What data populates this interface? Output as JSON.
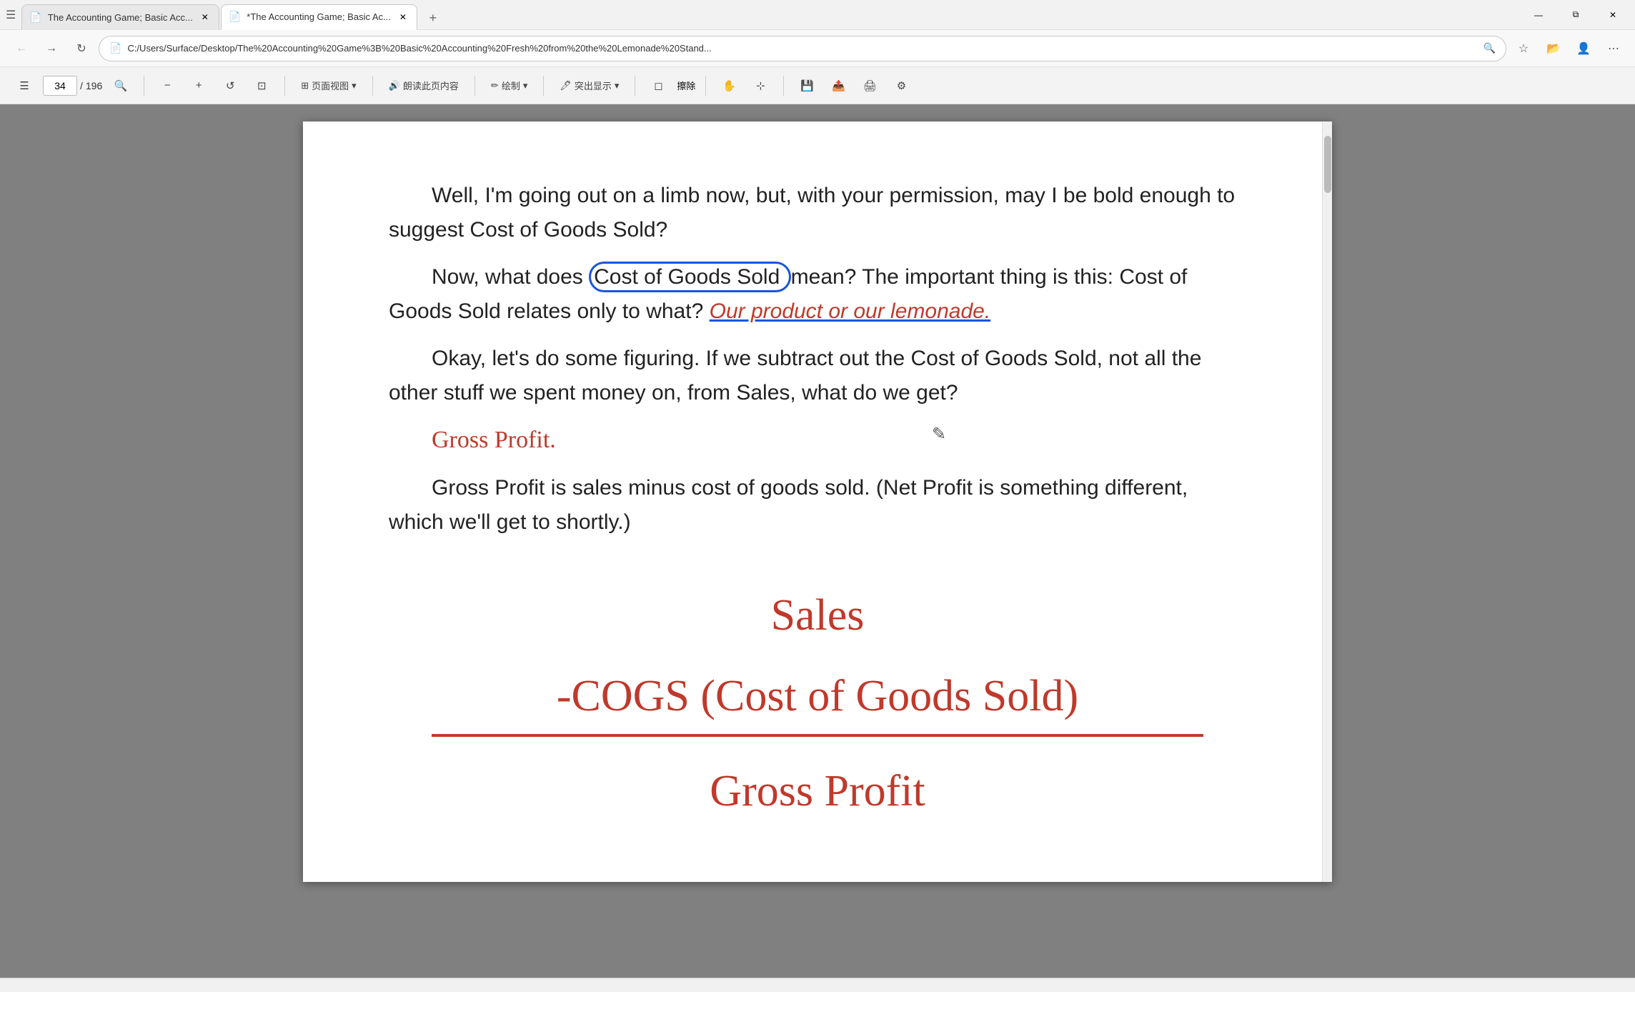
{
  "browser": {
    "title_bar_height": 42,
    "window_controls": {
      "minimize": "—",
      "maximize": "⧉",
      "close": "✕"
    },
    "tabs": [
      {
        "id": "tab1",
        "title": "The Accounting Game; Basic Acc...",
        "active": false,
        "icon": "pdf"
      },
      {
        "id": "tab2",
        "title": "*The Accounting Game; Basic Ac...",
        "active": true,
        "icon": "pdf"
      }
    ],
    "new_tab_label": "+",
    "address_bar": {
      "icon": "🔒",
      "url": "C:/Users/Surface/Desktop/The%20Accounting%20Game%3B%20Basic%20Accounting%20Fresh%20from%20the%20Lemonade%20Stand..."
    }
  },
  "toolbar": {
    "back_btn": "←",
    "forward_btn": "→",
    "refresh_btn": "↻",
    "home_btn": "⌂"
  },
  "pdf_toolbar": {
    "menu_btn": "☰",
    "current_page": "34",
    "total_pages": "196",
    "search_btn": "🔍",
    "zoom_out": "−",
    "zoom_in": "+",
    "rotate_left": "↺",
    "fit_btn": "⊡",
    "view_label": "页面视图",
    "read_label": "朗读此页内容",
    "draw_label": "绘制",
    "highlight_label": "突出显示",
    "erase_label": "擦除",
    "hand_btn": "✋",
    "select_btn": "⬚",
    "save_btn": "💾",
    "save_as_btn": "📤",
    "print_btn": "🖨",
    "settings_btn": "⚙"
  },
  "pdf_content": {
    "paragraph1": "Well, I'm going out on a limb now, but, with your permission, may I be bold enough to suggest Cost of Goods Sold?",
    "paragraph2_before": "Now, what does",
    "paragraph2_highlight": "Cost of Goods Sold",
    "paragraph2_after": "mean? The important thing is this: Cost of Goods Sold relates only to what?",
    "paragraph2_red": "Our product or our lemonade.",
    "paragraph3": "Okay, let's do some figuring. If we subtract out the Cost of Goods Sold, not all the other stuff we spent money on, from Sales, what do we get?",
    "gross_profit_handwritten": "Gross Profit.",
    "paragraph4": "Gross Profit is sales minus cost of goods sold. (Net Profit is something different, which we'll get to shortly.)",
    "formula": {
      "sales_label": "Sales",
      "cogs_label": "-COGS (Cost of Goods Sold)",
      "gross_profit_label": "Gross Profit"
    }
  }
}
